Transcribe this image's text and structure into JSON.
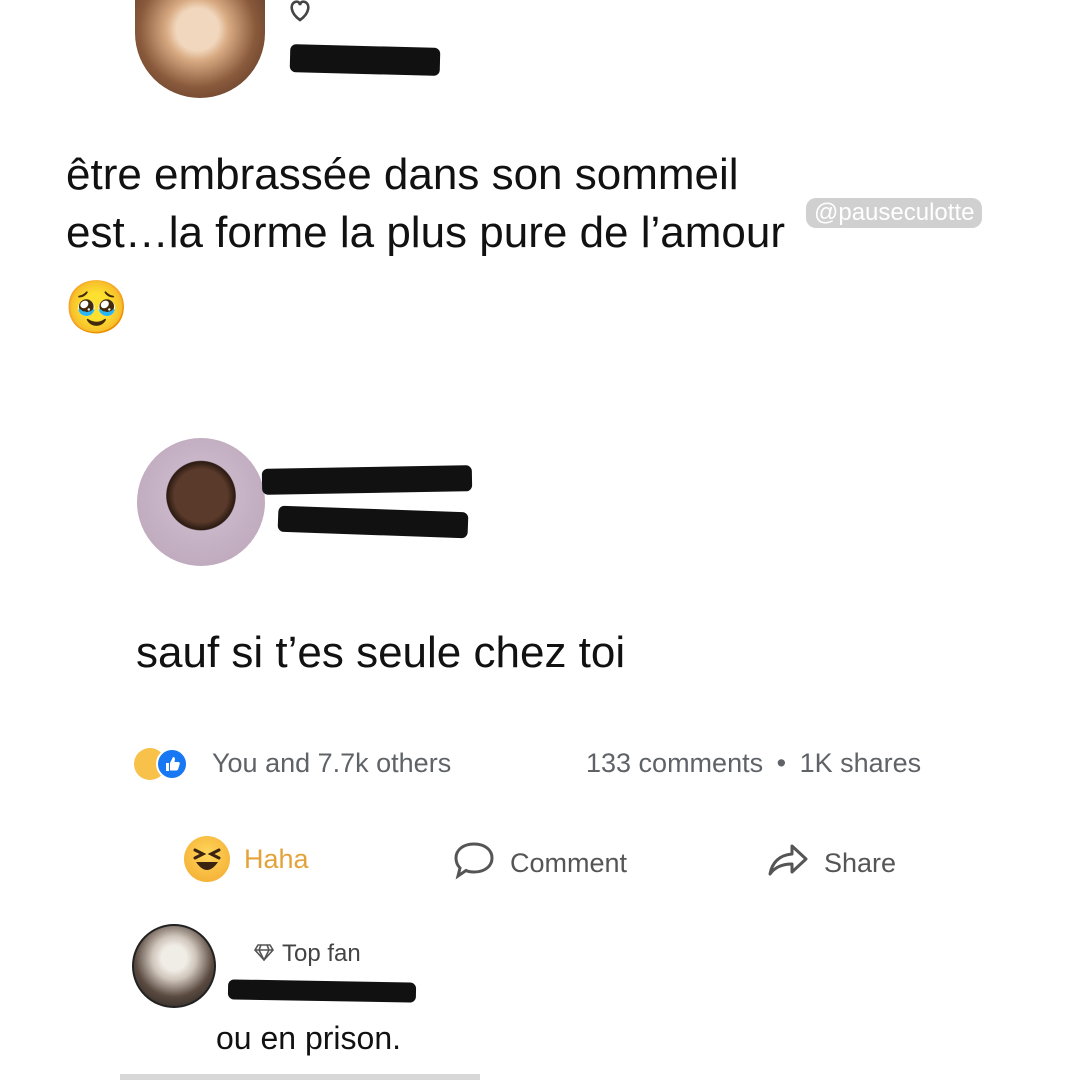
{
  "watermark": "@pauseculotte",
  "post1": {
    "text_line1": "être embrassée dans son sommeil",
    "text_line2": "est…la forme la plus pure de l’amour",
    "emoji": "🥹",
    "heart_icon": "heart-outline-icon"
  },
  "post2": {
    "text": "sauf si t’es seule chez toi"
  },
  "reactions": {
    "summary": "You and 7.7k others",
    "comments": "133 comments",
    "separator": "•",
    "shares": "1K shares"
  },
  "actions": {
    "haha": "Haha",
    "comment": "Comment",
    "share": "Share"
  },
  "comment": {
    "badge": "Top fan",
    "text": "ou en prison."
  },
  "colors": {
    "haha": "#e4a33a",
    "like_blue": "#1877f2",
    "muted": "#5f6368"
  }
}
